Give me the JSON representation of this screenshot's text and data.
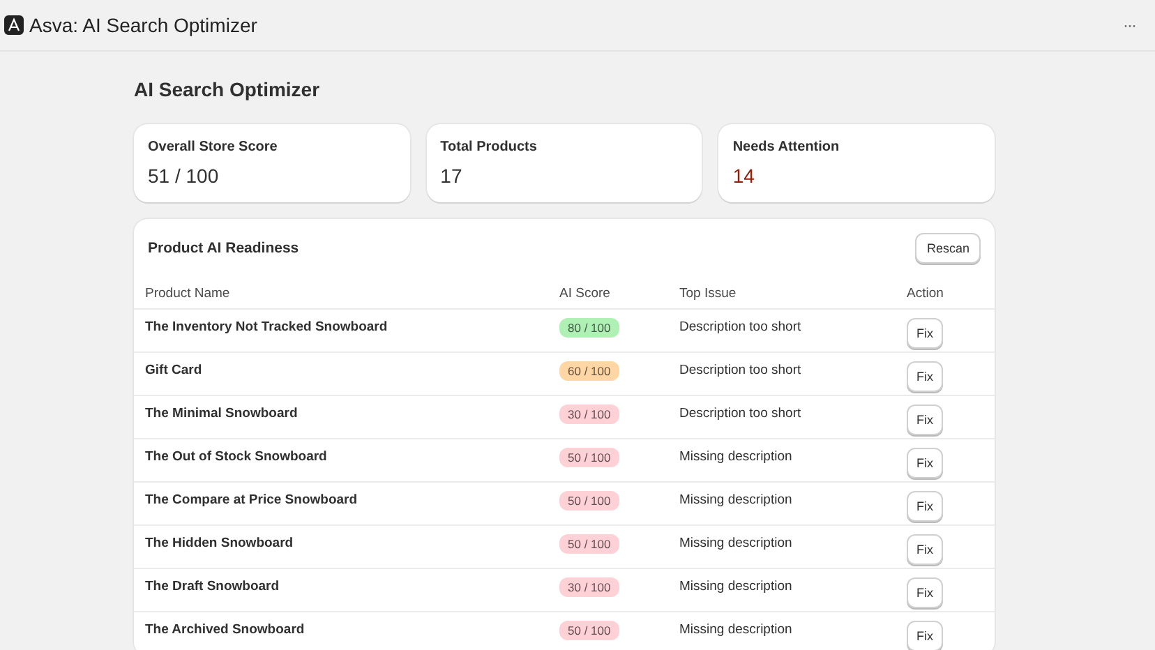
{
  "window": {
    "title": "Asva: AI Search Optimizer",
    "menu": "···"
  },
  "page_title": "AI Search Optimizer",
  "stats": [
    {
      "label": "Overall Store Score",
      "value": "51 / 100",
      "color": "#303030"
    },
    {
      "label": "Total Products",
      "value": "17",
      "color": "#303030"
    },
    {
      "label": "Needs Attention",
      "value": "14",
      "color": "#8e1f0b"
    }
  ],
  "table": {
    "title": "Product AI Readiness",
    "action": "Rescan",
    "columns": [
      "Product Name",
      "AI Score",
      "Top Issue",
      "Action"
    ],
    "rows": [
      {
        "name": "The Inventory Not Tracked Snowboard",
        "score": "80 / 100",
        "color": "#aff0b5",
        "issue": "Description too short",
        "action": "Fix"
      },
      {
        "name": "Gift Card",
        "score": "60 / 100",
        "color": "#ffd6a4",
        "issue": "Description too short",
        "action": "Fix"
      },
      {
        "name": "The Minimal Snowboard",
        "score": "30 / 100",
        "color": "#fed1d7",
        "issue": "Description too short",
        "action": "Fix"
      },
      {
        "name": "The Out of Stock Snowboard",
        "score": "50 / 100",
        "color": "#fed1d7",
        "issue": "Missing description",
        "action": "Fix"
      },
      {
        "name": "The Compare at Price Snowboard",
        "score": "50 / 100",
        "color": "#fed1d7",
        "issue": "Missing description",
        "action": "Fix"
      },
      {
        "name": "The Hidden Snowboard",
        "score": "50 / 100",
        "color": "#fed1d7",
        "issue": "Missing description",
        "action": "Fix"
      },
      {
        "name": "The Draft Snowboard",
        "score": "30 / 100",
        "color": "#fed1d7",
        "issue": "Missing description",
        "action": "Fix"
      },
      {
        "name": "The Archived Snowboard",
        "score": "50 / 100",
        "color": "#fed1d7",
        "issue": "Missing description",
        "action": "Fix"
      }
    ]
  }
}
